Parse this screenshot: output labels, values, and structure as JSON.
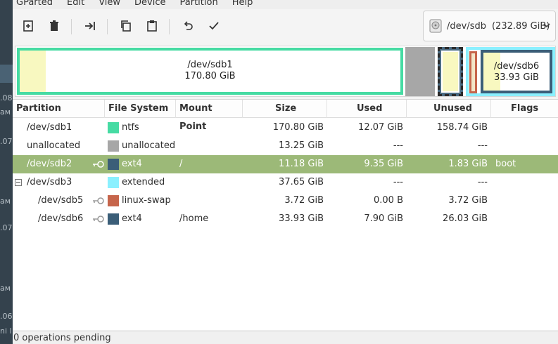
{
  "background_fragments": [
    ".08",
    "ам",
    ".07",
    "ам",
    ".07",
    "ам",
    ".06",
    "ni l"
  ],
  "menubar": {
    "items": [
      "GParted",
      "Edit",
      "View",
      "Device",
      "Partition",
      "Help"
    ]
  },
  "toolbar": {
    "buttons": [
      "new-icon",
      "delete-icon",
      "resize-move-icon",
      "copy-icon",
      "paste-icon",
      "undo-icon",
      "apply-icon"
    ]
  },
  "device": {
    "name": "/dev/sdb",
    "size": "(232.89 GiB)"
  },
  "graphic": {
    "sdb1": {
      "name": "/dev/sdb1",
      "size": "170.80 GiB"
    },
    "sdb6": {
      "name": "/dev/sdb6",
      "size": "33.93 GiB"
    }
  },
  "columns": [
    "Partition",
    "File System",
    "Mount Point",
    "Size",
    "Used",
    "Unused",
    "Flags"
  ],
  "rows": [
    {
      "partition": "/dev/sdb1",
      "fs": "ntfs",
      "mount": "",
      "size": "170.80 GiB",
      "used": "12.07 GiB",
      "unused": "158.74 GiB",
      "flags": "",
      "color": "#46dba3"
    },
    {
      "partition": "unallocated",
      "fs": "unallocated",
      "mount": "",
      "size": "13.25 GiB",
      "used": "---",
      "unused": "---",
      "flags": "",
      "color": "#a7a7a7"
    },
    {
      "partition": "/dev/sdb2",
      "fs": "ext4",
      "mount": "/",
      "size": "11.18 GiB",
      "used": "9.35 GiB",
      "unused": "1.83 GiB",
      "flags": "boot",
      "color": "#3b5e78"
    },
    {
      "partition": "/dev/sdb3",
      "fs": "extended",
      "mount": "",
      "size": "37.65 GiB",
      "used": "---",
      "unused": "---",
      "flags": "",
      "color": "#8bf0ff"
    },
    {
      "partition": "/dev/sdb5",
      "fs": "linux-swap",
      "mount": "",
      "size": "3.72 GiB",
      "used": "0.00 B",
      "unused": "3.72 GiB",
      "flags": "",
      "color": "#c6654b"
    },
    {
      "partition": "/dev/sdb6",
      "fs": "ext4",
      "mount": "/home",
      "size": "33.93 GiB",
      "used": "7.90 GiB",
      "unused": "26.03 GiB",
      "flags": "",
      "color": "#3b5e78"
    }
  ],
  "selected_row": 2,
  "status": {
    "text": "0 operations pending"
  }
}
